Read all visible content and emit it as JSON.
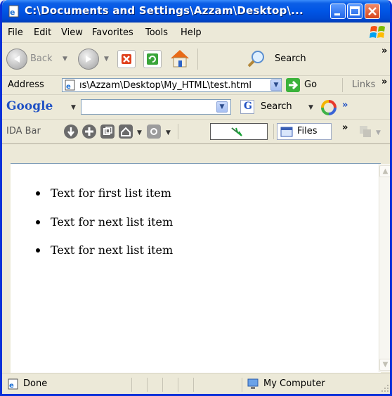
{
  "window": {
    "title": "C:\\Documents and Settings\\Azzam\\Desktop\\...",
    "accent": "#0055e5"
  },
  "menubar": {
    "items": [
      "File",
      "Edit",
      "View",
      "Favorites",
      "Tools",
      "Help"
    ]
  },
  "toolbar": {
    "back_label": "Back",
    "search_label": "Search",
    "more_chevron": "»"
  },
  "address": {
    "label": "Address",
    "value": "ıs\\Azzam\\Desktop\\My_HTML\\test.html",
    "go_label": "Go",
    "links_label": "Links",
    "links_chevron": "»"
  },
  "google": {
    "logo": "Google",
    "search_label": "Search",
    "search_value": "",
    "more_chevron": "»"
  },
  "idabar": {
    "label": "IDA Bar",
    "files_label": "Files",
    "more_chevron": "»"
  },
  "content": {
    "list_items": [
      "Text for first list item",
      "Text for next list item",
      "Text for next list item"
    ]
  },
  "statusbar": {
    "status": "Done",
    "zone": "My Computer"
  }
}
